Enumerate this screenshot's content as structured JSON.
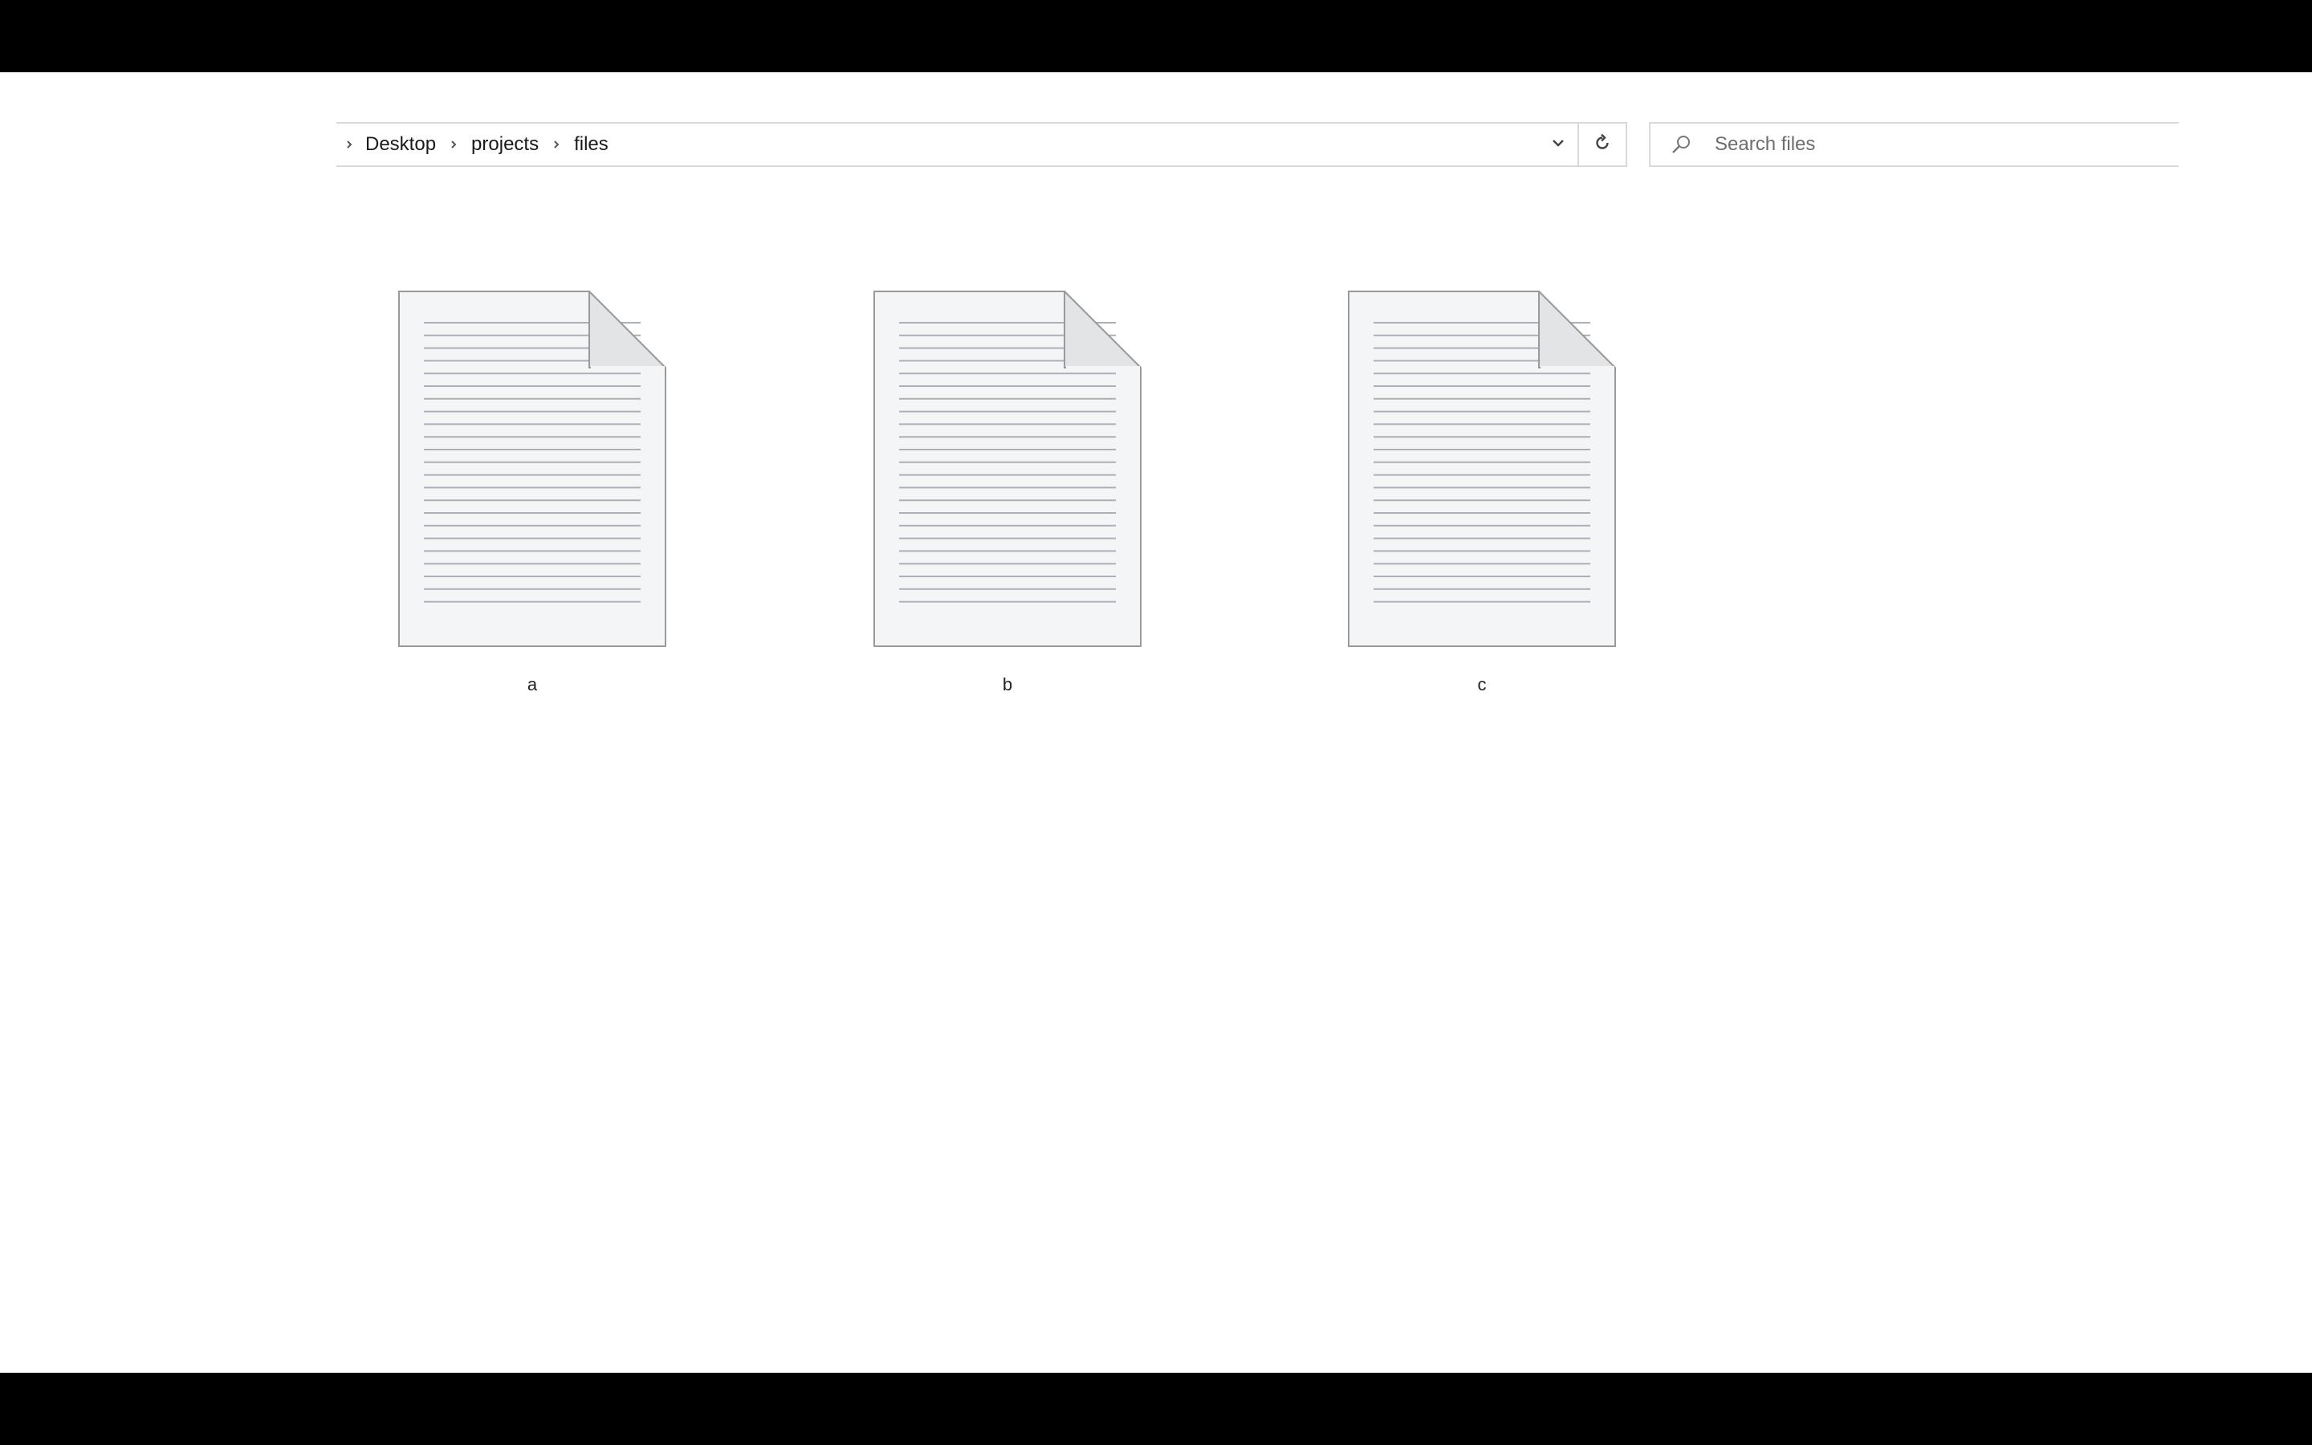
{
  "address_bar": {
    "crumbs": [
      "Desktop",
      "projects",
      "files"
    ]
  },
  "search": {
    "placeholder": "Search files",
    "value": ""
  },
  "files": [
    {
      "name": "a",
      "icon": "text-document-icon"
    },
    {
      "name": "b",
      "icon": "text-document-icon"
    },
    {
      "name": "c",
      "icon": "text-document-icon"
    }
  ],
  "colors": {
    "frame": "#000000",
    "window_bg": "#ffffff",
    "border": "#d9d9d9",
    "doc_line": "#aab0b8"
  }
}
